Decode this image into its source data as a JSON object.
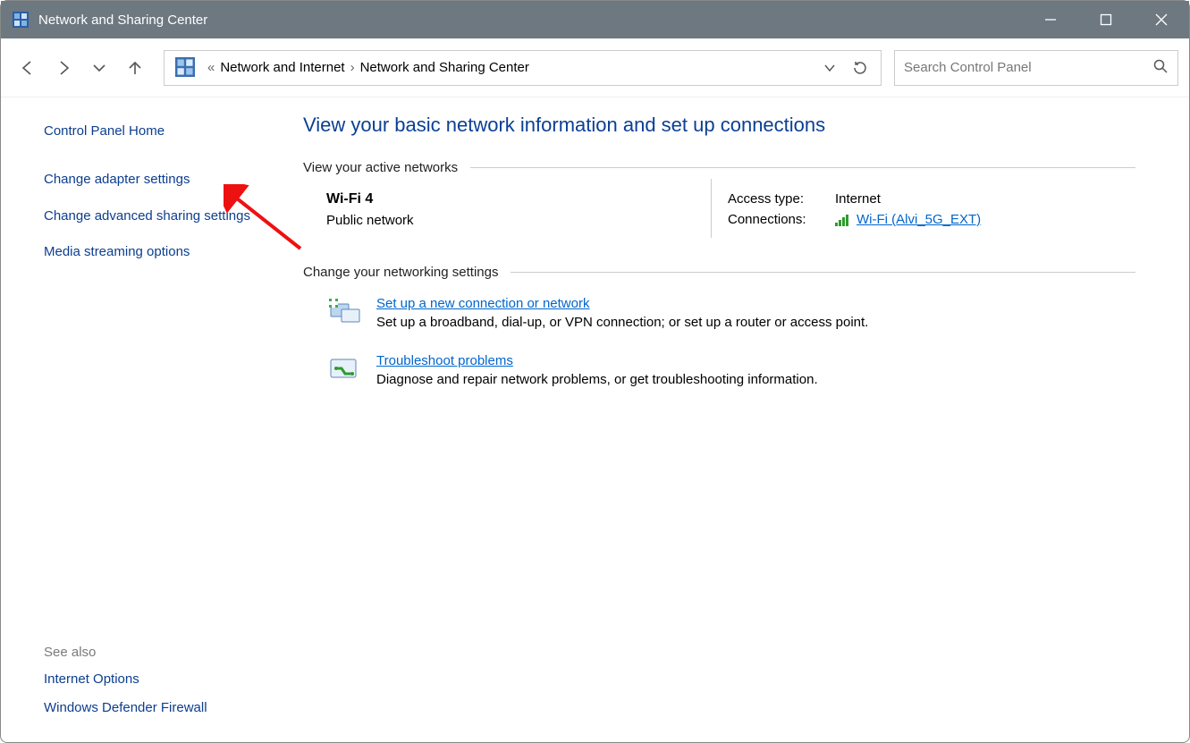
{
  "window": {
    "title": "Network and Sharing Center"
  },
  "breadcrumb": {
    "item1": "Network and Internet",
    "item2": "Network and Sharing Center"
  },
  "search": {
    "placeholder": "Search Control Panel"
  },
  "sidebar": {
    "home": "Control Panel Home",
    "adapter": "Change adapter settings",
    "advanced": "Change advanced sharing settings",
    "media": "Media streaming options",
    "see_also": "See also",
    "internet_options": "Internet Options",
    "firewall": "Windows Defender Firewall"
  },
  "main": {
    "heading": "View your basic network information and set up connections",
    "active_head": "View your active networks",
    "net_name": "Wi-Fi 4",
    "net_type": "Public network",
    "access_lbl": "Access type:",
    "access_val": "Internet",
    "conn_lbl": "Connections:",
    "conn_val": "Wi-Fi (Alvi_5G_EXT)",
    "change_head": "Change your networking settings",
    "setup_link": "Set up a new connection or network",
    "setup_desc": "Set up a broadband, dial-up, or VPN connection; or set up a router or access point.",
    "troubleshoot_link": "Troubleshoot problems",
    "troubleshoot_desc": "Diagnose and repair network problems, or get troubleshooting information."
  }
}
